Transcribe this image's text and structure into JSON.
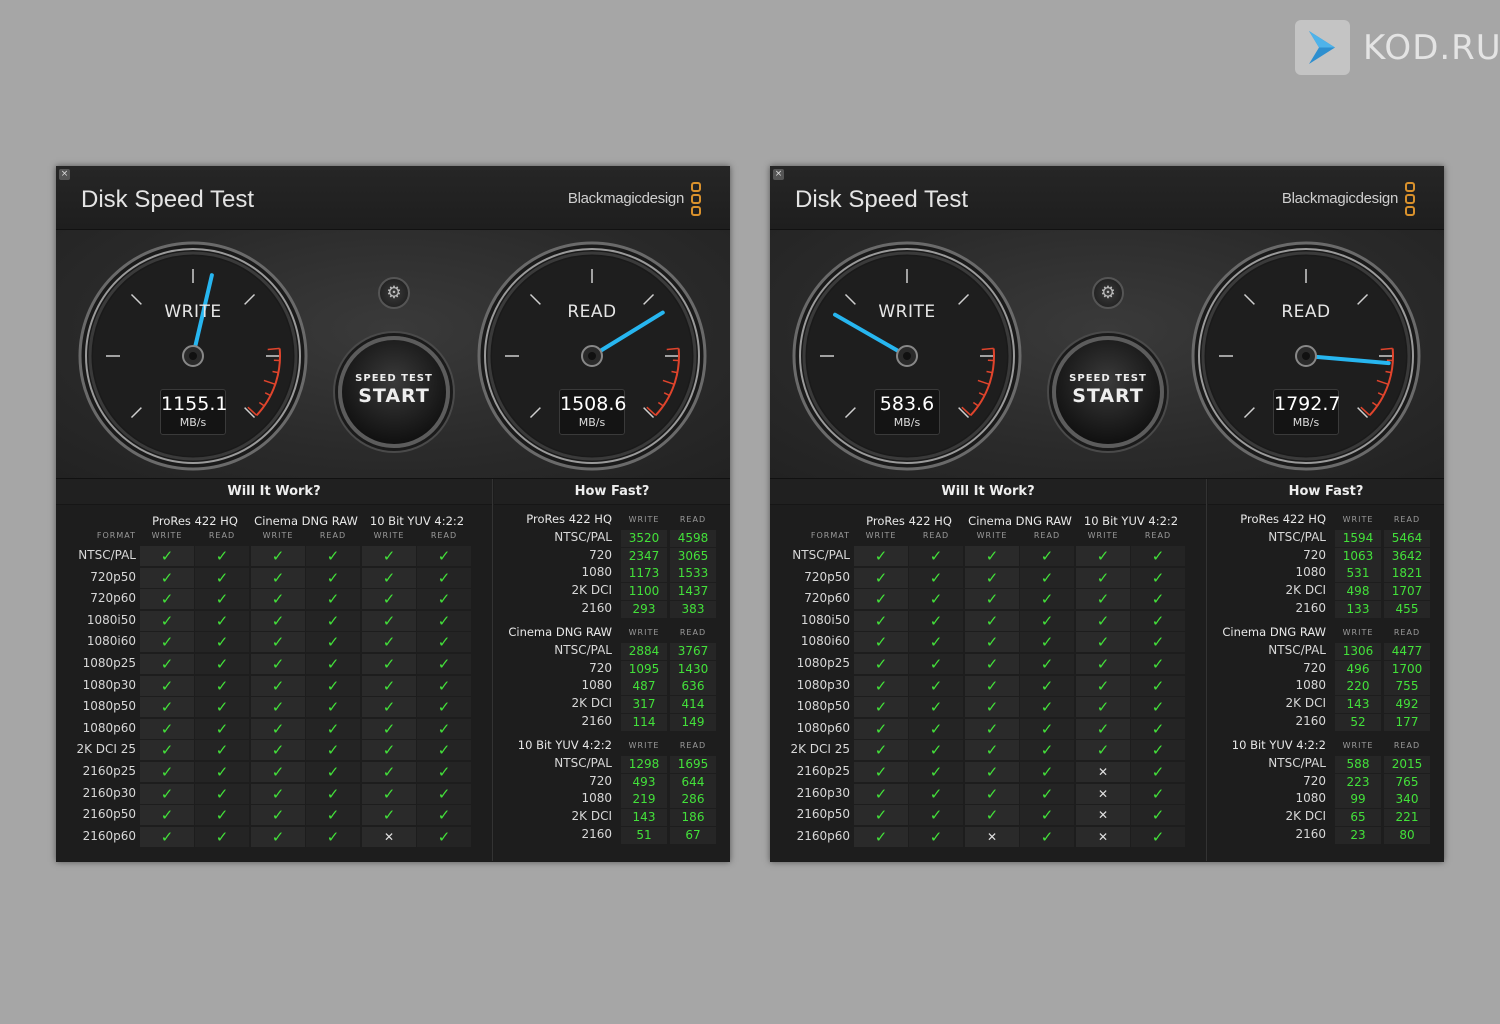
{
  "watermark": {
    "text": "KOD.RU",
    "icon": "play-arrow-icon"
  },
  "windows": [
    {
      "close": "×",
      "title": "Disk Speed Test",
      "brand": "Blackmagicdesign",
      "write": {
        "label": "WRITE",
        "value": "1155.1",
        "unit": "MB/s",
        "needle_speed": 1155.1
      },
      "read": {
        "label": "READ",
        "value": "1508.6",
        "unit": "MB/s",
        "needle_speed": 1508.6
      },
      "start": {
        "small": "SPEED TEST",
        "big": "START"
      },
      "will_it_work": {
        "title": "Will It Work?",
        "format_label": "FORMAT",
        "groups": [
          "ProRes 422 HQ",
          "Cinema DNG RAW",
          "10 Bit YUV 4:2:2"
        ],
        "sub": [
          "WRITE",
          "READ"
        ],
        "rows": [
          {
            "f": "NTSC/PAL",
            "v": [
              1,
              1,
              1,
              1,
              1,
              1
            ]
          },
          {
            "f": "720p50",
            "v": [
              1,
              1,
              1,
              1,
              1,
              1
            ]
          },
          {
            "f": "720p60",
            "v": [
              1,
              1,
              1,
              1,
              1,
              1
            ]
          },
          {
            "f": "1080i50",
            "v": [
              1,
              1,
              1,
              1,
              1,
              1
            ]
          },
          {
            "f": "1080i60",
            "v": [
              1,
              1,
              1,
              1,
              1,
              1
            ]
          },
          {
            "f": "1080p25",
            "v": [
              1,
              1,
              1,
              1,
              1,
              1
            ]
          },
          {
            "f": "1080p30",
            "v": [
              1,
              1,
              1,
              1,
              1,
              1
            ]
          },
          {
            "f": "1080p50",
            "v": [
              1,
              1,
              1,
              1,
              1,
              1
            ]
          },
          {
            "f": "1080p60",
            "v": [
              1,
              1,
              1,
              1,
              1,
              1
            ]
          },
          {
            "f": "2K DCI 25",
            "v": [
              1,
              1,
              1,
              1,
              1,
              1
            ]
          },
          {
            "f": "2160p25",
            "v": [
              1,
              1,
              1,
              1,
              1,
              1
            ]
          },
          {
            "f": "2160p30",
            "v": [
              1,
              1,
              1,
              1,
              1,
              1
            ]
          },
          {
            "f": "2160p50",
            "v": [
              1,
              1,
              1,
              1,
              1,
              1
            ]
          },
          {
            "f": "2160p60",
            "v": [
              1,
              1,
              1,
              1,
              0,
              1
            ]
          }
        ]
      },
      "how_fast": {
        "title": "How Fast?",
        "groups": [
          {
            "name": "ProRes 422 HQ",
            "rows": [
              [
                "NTSC/PAL",
                "3520",
                "4598"
              ],
              [
                "720",
                "2347",
                "3065"
              ],
              [
                "1080",
                "1173",
                "1533"
              ],
              [
                "2K DCI",
                "1100",
                "1437"
              ],
              [
                "2160",
                "293",
                "383"
              ]
            ]
          },
          {
            "name": "Cinema DNG RAW",
            "rows": [
              [
                "NTSC/PAL",
                "2884",
                "3767"
              ],
              [
                "720",
                "1095",
                "1430"
              ],
              [
                "1080",
                "487",
                "636"
              ],
              [
                "2K DCI",
                "317",
                "414"
              ],
              [
                "2160",
                "114",
                "149"
              ]
            ]
          },
          {
            "name": "10 Bit YUV 4:2:2",
            "rows": [
              [
                "NTSC/PAL",
                "1298",
                "1695"
              ],
              [
                "720",
                "493",
                "644"
              ],
              [
                "1080",
                "219",
                "286"
              ],
              [
                "2K DCI",
                "143",
                "186"
              ],
              [
                "2160",
                "51",
                "67"
              ]
            ]
          }
        ]
      }
    },
    {
      "close": "×",
      "title": "Disk Speed Test",
      "brand": "Blackmagicdesign",
      "write": {
        "label": "WRITE",
        "value": "583.6",
        "unit": "MB/s",
        "needle_speed": 583.6
      },
      "read": {
        "label": "READ",
        "value": "1792.7",
        "unit": "MB/s",
        "needle_speed": 1792.7
      },
      "start": {
        "small": "SPEED TEST",
        "big": "START"
      },
      "will_it_work": {
        "title": "Will It Work?",
        "format_label": "FORMAT",
        "groups": [
          "ProRes 422 HQ",
          "Cinema DNG RAW",
          "10 Bit YUV 4:2:2"
        ],
        "sub": [
          "WRITE",
          "READ"
        ],
        "rows": [
          {
            "f": "NTSC/PAL",
            "v": [
              1,
              1,
              1,
              1,
              1,
              1
            ]
          },
          {
            "f": "720p50",
            "v": [
              1,
              1,
              1,
              1,
              1,
              1
            ]
          },
          {
            "f": "720p60",
            "v": [
              1,
              1,
              1,
              1,
              1,
              1
            ]
          },
          {
            "f": "1080i50",
            "v": [
              1,
              1,
              1,
              1,
              1,
              1
            ]
          },
          {
            "f": "1080i60",
            "v": [
              1,
              1,
              1,
              1,
              1,
              1
            ]
          },
          {
            "f": "1080p25",
            "v": [
              1,
              1,
              1,
              1,
              1,
              1
            ]
          },
          {
            "f": "1080p30",
            "v": [
              1,
              1,
              1,
              1,
              1,
              1
            ]
          },
          {
            "f": "1080p50",
            "v": [
              1,
              1,
              1,
              1,
              1,
              1
            ]
          },
          {
            "f": "1080p60",
            "v": [
              1,
              1,
              1,
              1,
              1,
              1
            ]
          },
          {
            "f": "2K DCI 25",
            "v": [
              1,
              1,
              1,
              1,
              1,
              1
            ]
          },
          {
            "f": "2160p25",
            "v": [
              1,
              1,
              1,
              1,
              0,
              1
            ]
          },
          {
            "f": "2160p30",
            "v": [
              1,
              1,
              1,
              1,
              0,
              1
            ]
          },
          {
            "f": "2160p50",
            "v": [
              1,
              1,
              1,
              1,
              0,
              1
            ]
          },
          {
            "f": "2160p60",
            "v": [
              1,
              1,
              0,
              1,
              0,
              1
            ]
          }
        ]
      },
      "how_fast": {
        "title": "How Fast?",
        "groups": [
          {
            "name": "ProRes 422 HQ",
            "rows": [
              [
                "NTSC/PAL",
                "1594",
                "5464"
              ],
              [
                "720",
                "1063",
                "3642"
              ],
              [
                "1080",
                "531",
                "1821"
              ],
              [
                "2K DCI",
                "498",
                "1707"
              ],
              [
                "2160",
                "133",
                "455"
              ]
            ]
          },
          {
            "name": "Cinema DNG RAW",
            "rows": [
              [
                "NTSC/PAL",
                "1306",
                "4477"
              ],
              [
                "720",
                "496",
                "1700"
              ],
              [
                "1080",
                "220",
                "755"
              ],
              [
                "2K DCI",
                "143",
                "492"
              ],
              [
                "2160",
                "52",
                "177"
              ]
            ]
          },
          {
            "name": "10 Bit YUV 4:2:2",
            "rows": [
              [
                "NTSC/PAL",
                "588",
                "2015"
              ],
              [
                "720",
                "223",
                "765"
              ],
              [
                "1080",
                "99",
                "340"
              ],
              [
                "2K DCI",
                "65",
                "221"
              ],
              [
                "2160",
                "23",
                "80"
              ]
            ]
          }
        ]
      }
    }
  ],
  "colors": {
    "check": "#43e13a",
    "needle": "#27b6f0",
    "redline": "#e0442c",
    "brand_accent": "#d9912c"
  }
}
